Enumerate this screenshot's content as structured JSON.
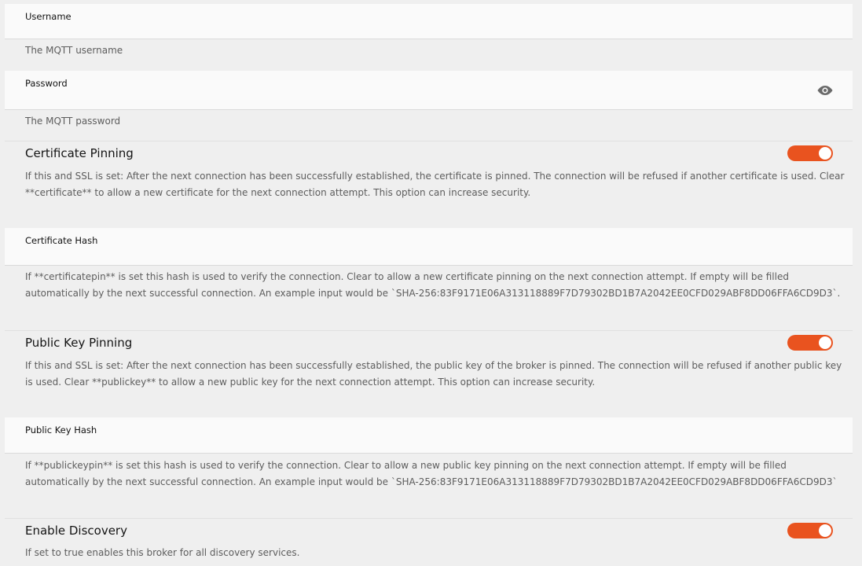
{
  "fields": {
    "username": {
      "label": "Username",
      "value": "",
      "help": "The MQTT username"
    },
    "password": {
      "label": "Password",
      "value": "",
      "help": "The MQTT password",
      "reveal_icon": "eye-icon"
    },
    "certificate_hash": {
      "label": "Certificate Hash",
      "value": "",
      "help": "If **certificatepin** is set this hash is used to verify the connection. Clear to allow a new certificate pinning on the next connection attempt. If empty will be filled automatically by the next successful connection. An example input would be `SHA-256:83F9171E06A313118889F7D79302BD1B7A2042EE0CFD029ABF8DD06FFA6CD9D3`."
    },
    "public_key_hash": {
      "label": "Public Key Hash",
      "value": "",
      "help": "If **publickeypin** is set this hash is used to verify the connection. Clear to allow a new public key pinning on the next connection attempt. If empty will be filled automatically by the next successful connection. An example input would be `SHA-256:83F9171E06A313118889F7D79302BD1B7A2042EE0CFD029ABF8DD06FFA6CD9D3`"
    }
  },
  "toggles": {
    "certificate_pinning": {
      "label": "Certificate Pinning",
      "enabled": true,
      "help": "If this and SSL is set: After the next connection has been successfully established, the certificate is pinned. The connection will be refused if another certificate is used. Clear **certificate** to allow a new certificate for the next connection attempt. This option can increase security."
    },
    "public_key_pinning": {
      "label": "Public Key Pinning",
      "enabled": true,
      "help": "If this and SSL is set: After the next connection has been successfully established, the public key of the broker is pinned. The connection will be refused if another public key is used. Clear **publickey** to allow a new public key for the next connection attempt. This option can increase security."
    },
    "enable_discovery": {
      "label": "Enable Discovery",
      "enabled": true,
      "help": "If set to true enables this broker for all discovery services."
    }
  },
  "colors": {
    "switch_on": "#e9531f",
    "page_bg": "#efefef",
    "field_bg": "#fafafa",
    "help_text": "#5d5d5d"
  }
}
